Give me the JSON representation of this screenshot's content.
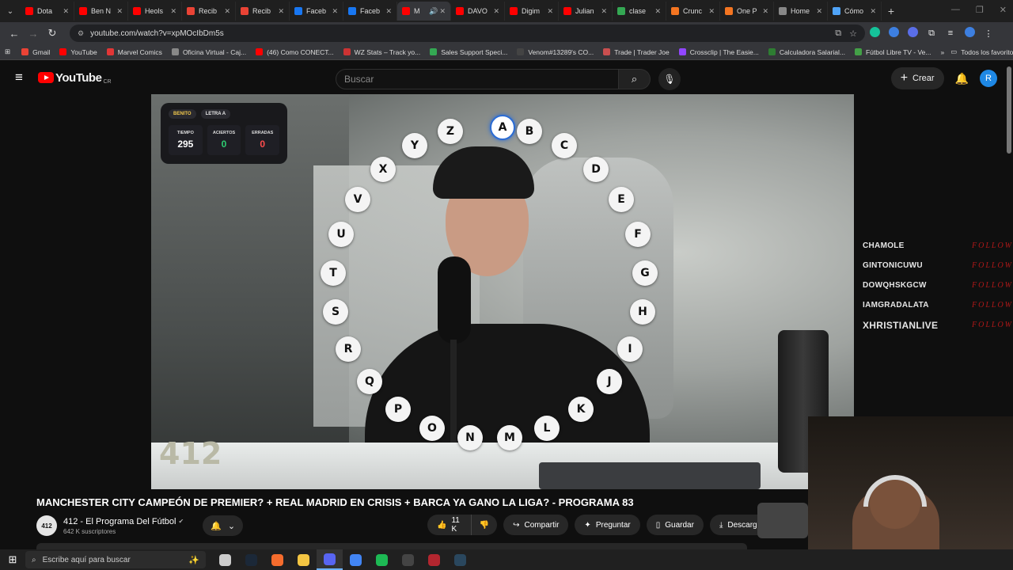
{
  "browser": {
    "tabs": [
      {
        "label": "Dota",
        "color": "#ff0000"
      },
      {
        "label": "Ben N",
        "color": "#ff0000"
      },
      {
        "label": "Heols",
        "color": "#ff0000"
      },
      {
        "label": "Recib",
        "color": "#ea4335"
      },
      {
        "label": "Recib",
        "color": "#ea4335"
      },
      {
        "label": "Faceb",
        "color": "#1877f2"
      },
      {
        "label": "Faceb",
        "color": "#1877f2"
      },
      {
        "label": "M",
        "color": "#ff0000",
        "active": true
      },
      {
        "label": "DAVO",
        "color": "#ff0000"
      },
      {
        "label": "Digim",
        "color": "#ff0000"
      },
      {
        "label": "Julian",
        "color": "#ff0000"
      },
      {
        "label": "clase",
        "color": "#34a853"
      },
      {
        "label": "Crunc",
        "color": "#f47521"
      },
      {
        "label": "One P",
        "color": "#f47521"
      },
      {
        "label": "Home",
        "color": "#888888"
      },
      {
        "label": "Cómo",
        "color": "#4fa3f7"
      }
    ],
    "url": "youtube.com/watch?v=xpMOcIbDm5s",
    "bookmarks": [
      {
        "label": "Gmail",
        "color": "#ea4335"
      },
      {
        "label": "YouTube",
        "color": "#ff0000"
      },
      {
        "label": "Marvel Comics",
        "color": "#e23636"
      },
      {
        "label": "Oficina Virtual - Caj...",
        "color": "#888888"
      },
      {
        "label": "(46) Como CONECT...",
        "color": "#ff0000"
      },
      {
        "label": "WZ Stats – Track yo...",
        "color": "#cc3333"
      },
      {
        "label": "Sales Support Speci...",
        "color": "#34a853"
      },
      {
        "label": "Venom#13289's CO...",
        "color": "#444444"
      },
      {
        "label": "Trade | Trader Joe",
        "color": "#c94f4f"
      },
      {
        "label": "Crossclip | The Easie...",
        "color": "#9146ff"
      },
      {
        "label": "Calculadora Salarial...",
        "color": "#2e7d32"
      },
      {
        "label": "Fútbol Libre TV - Ve...",
        "color": "#43a047"
      }
    ],
    "bookmarks_more": "»",
    "all_favorites": "Todos los favoritos"
  },
  "youtube": {
    "logo_text": "YouTube",
    "country_code": "CR",
    "search_placeholder": "Buscar",
    "create_label": "Crear",
    "avatar_letter": "R"
  },
  "overlay": {
    "player_name": "BENITO",
    "letter_tag": "LETRA A",
    "labels": {
      "time": "TIEMPO",
      "hits": "ACIERTOS",
      "misses": "ERRADAS"
    },
    "values": {
      "time": "295",
      "hits": "0",
      "misses": "0"
    },
    "hits_color": "#2ecc71",
    "misses_color": "#ff4d4d",
    "wheel_letters": [
      "A",
      "B",
      "C",
      "D",
      "E",
      "F",
      "G",
      "H",
      "I",
      "J",
      "K",
      "L",
      "M",
      "N",
      "O",
      "P",
      "Q",
      "R",
      "S",
      "T",
      "U",
      "V",
      "X",
      "Y",
      "Z"
    ],
    "active_letter": "A",
    "studio_logo": "412"
  },
  "stream_followers": [
    {
      "name": "CHAMOLE",
      "action": "FOLLOW"
    },
    {
      "name": "GINTONICUWU",
      "action": "FOLLOW"
    },
    {
      "name": "DOWQHSKGCW",
      "action": "FOLLOW"
    },
    {
      "name": "IAMGRADALATA",
      "action": "FOLLOW"
    },
    {
      "name": "XHRISTIANLIVE",
      "action": "FOLLOW"
    }
  ],
  "video": {
    "title": "MANCHESTER CITY CAMPEÓN DE PREMIER? + REAL MADRID EN CRISIS + BARCA YA GANO LA LIGA? - PROGRAMA 83",
    "channel_name": "412 - El Programa Del Fútbol",
    "channel_avatar_text": "412",
    "subscribers": "642 K suscriptores",
    "likes": "11 K",
    "actions": {
      "share": "Compartir",
      "ask": "Preguntar",
      "save": "Guardar",
      "download": "Descargar"
    }
  },
  "taskbar": {
    "search_placeholder": "Escribe aquí para buscar",
    "apps": [
      {
        "name": "task-view",
        "color": "#cccccc"
      },
      {
        "name": "steam",
        "color": "#1b2838"
      },
      {
        "name": "origin",
        "color": "#f56c2d"
      },
      {
        "name": "file-explorer",
        "color": "#f4c542"
      },
      {
        "name": "discord-like",
        "color": "#5865f2",
        "active": true
      },
      {
        "name": "chrome",
        "color": "#4285f4"
      },
      {
        "name": "spotify",
        "color": "#1db954"
      },
      {
        "name": "obs",
        "color": "#444444"
      },
      {
        "name": "gaming-app",
        "color": "#b3262f"
      },
      {
        "name": "steam-2",
        "color": "#2a475e"
      }
    ]
  }
}
